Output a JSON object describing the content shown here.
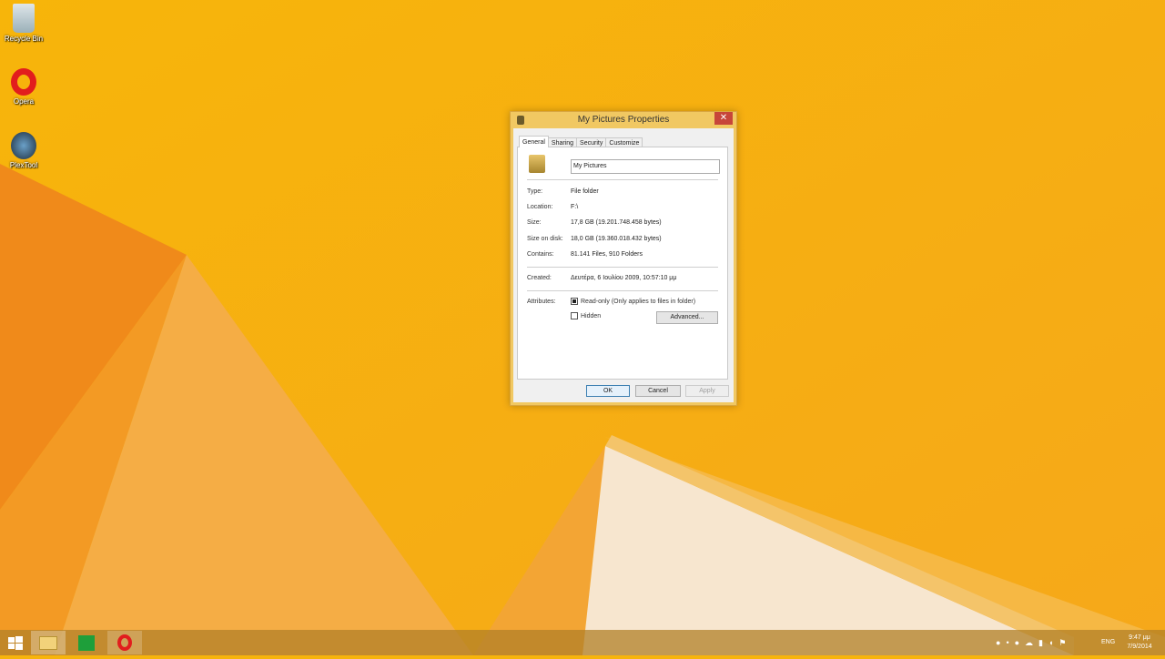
{
  "desktop": {
    "icons": [
      {
        "label": "Recycle Bin"
      },
      {
        "label": "Opera"
      },
      {
        "label": "PlexTool"
      }
    ]
  },
  "dialog": {
    "title": "My Pictures Properties",
    "tabs": [
      "General",
      "Sharing",
      "Security",
      "Customize"
    ],
    "name_value": "My Pictures",
    "props": [
      {
        "label": "Type:",
        "value": "File folder"
      },
      {
        "label": "Location:",
        "value": "F:\\"
      },
      {
        "label": "Size:",
        "value": "17,8 GB (19.201.748.458 bytes)"
      },
      {
        "label": "Size on disk:",
        "value": "18,0 GB (19.360.018.432 bytes)"
      },
      {
        "label": "Contains:",
        "value": "81.141 Files, 910 Folders"
      }
    ],
    "created": {
      "label": "Created:",
      "value": "Δευτέρα, 6 Ιουλίου 2009, 10:57:10 μμ"
    },
    "attributes": {
      "label": "Attributes:",
      "readonly": "Read-only (Only applies to files in folder)",
      "readonly_checked": true,
      "hidden": "Hidden",
      "hidden_checked": false,
      "advanced": "Advanced..."
    },
    "buttons": {
      "ok": "OK",
      "cancel": "Cancel",
      "apply": "Apply"
    }
  },
  "taskbar": {
    "language": "ENG",
    "time": "9:47 μμ",
    "date": "7/9/2014"
  }
}
